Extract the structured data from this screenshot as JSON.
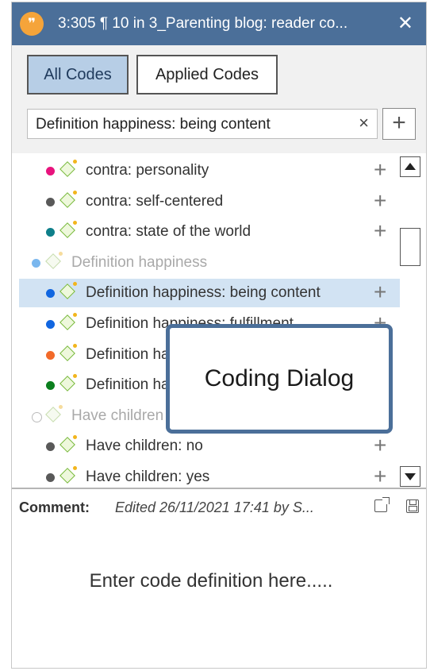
{
  "window": {
    "title": "3:305 ¶ 10 in 3_Parenting blog: reader co...",
    "title_icon": "quotation-bubble-icon",
    "close_glyph": "✕",
    "titlebar_color": "#4b6f99"
  },
  "toolbar": {
    "all_codes_label": "All Codes",
    "applied_codes_label": "Applied Codes",
    "active_tab": "All Codes"
  },
  "search": {
    "value": "Definition happiness: being content",
    "clear_glyph": "×",
    "add_glyph": "+"
  },
  "codes": [
    {
      "label": "contra: personality",
      "color": "#e8137d",
      "faded": false,
      "selected": false,
      "indent": 1
    },
    {
      "label": "contra: self-centered",
      "color": "#595959",
      "faded": false,
      "selected": false,
      "indent": 1
    },
    {
      "label": "contra: state of the world",
      "color": "#0e7f8a",
      "faded": false,
      "selected": false,
      "indent": 1
    },
    {
      "label": "Definition happiness",
      "color": "#7ab7ee",
      "faded": true,
      "selected": false,
      "indent": 0
    },
    {
      "label": "Definition happiness: being content",
      "color": "#1166e0",
      "faded": false,
      "selected": true,
      "indent": 1
    },
    {
      "label": "Definition happiness: fulfillment",
      "color": "#1166e0",
      "faded": false,
      "selected": false,
      "indent": 1
    },
    {
      "label": "Definition happiness: ...",
      "color": "#f26a2a",
      "faded": false,
      "selected": false,
      "indent": 1
    },
    {
      "label": "Definition happiness: ...",
      "color": "#0b7f1e",
      "faded": false,
      "selected": false,
      "indent": 1
    },
    {
      "label": "Have children",
      "color": "#ffffff",
      "faded": true,
      "selected": false,
      "indent": 0
    },
    {
      "label": "Have children: no",
      "color": "#595959",
      "faded": false,
      "selected": false,
      "indent": 1
    },
    {
      "label": "Have children: yes",
      "color": "#595959",
      "faded": false,
      "selected": false,
      "indent": 1
    }
  ],
  "comment": {
    "label": "Comment:",
    "meta": "Edited 26/11/2021 17:41 by S...",
    "placeholder": "Enter code definition here....."
  },
  "overlay": {
    "text": "Coding Dialog"
  }
}
